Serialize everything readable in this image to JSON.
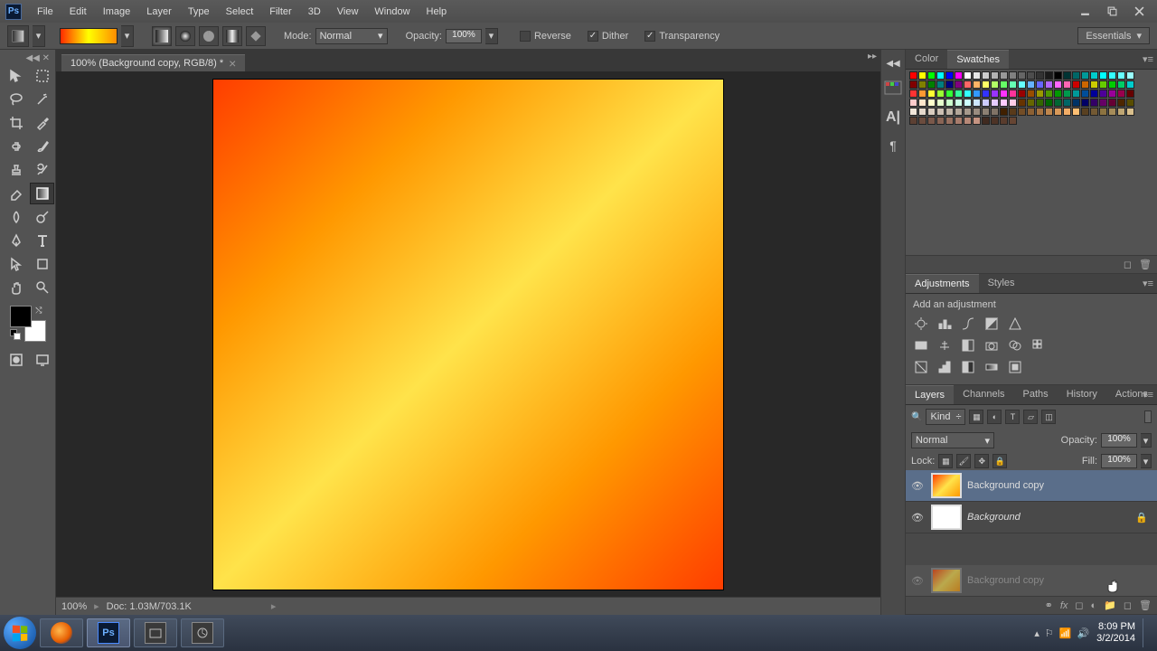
{
  "menu": {
    "items": [
      "File",
      "Edit",
      "Image",
      "Layer",
      "Type",
      "Select",
      "Filter",
      "3D",
      "View",
      "Window",
      "Help"
    ]
  },
  "window_controls": {
    "minimize": "–",
    "maximize": "❐",
    "close": "✕"
  },
  "options": {
    "mode_label": "Mode:",
    "mode_value": "Normal",
    "opacity_label": "Opacity:",
    "opacity_value": "100%",
    "reverse": "Reverse",
    "dither": "Dither",
    "transparency": "Transparency",
    "workspace": "Essentials"
  },
  "doc_tab": {
    "title": "100% (Background copy, RGB/8) *"
  },
  "status": {
    "zoom": "100%",
    "doc": "Doc: 1.03M/703.1K"
  },
  "color_panel": {
    "tabs": [
      "Color",
      "Swatches"
    ]
  },
  "adjustments_panel": {
    "tabs": [
      "Adjustments",
      "Styles"
    ],
    "add_label": "Add an adjustment"
  },
  "layers_panel": {
    "tabs": [
      "Layers",
      "Channels",
      "Paths",
      "History",
      "Actions"
    ],
    "kind": "Kind",
    "blend_mode": "Normal",
    "opacity_label": "Opacity:",
    "opacity_value": "100%",
    "lock_label": "Lock:",
    "fill_label": "Fill:",
    "fill_value": "100%",
    "layers": [
      {
        "name": "Background copy",
        "selected": true,
        "thumb": "grad",
        "locked": false,
        "visible": true,
        "italic": false
      },
      {
        "name": "Background",
        "selected": false,
        "thumb": "white",
        "locked": true,
        "visible": true,
        "italic": true
      }
    ],
    "ghost_name": "Background copy"
  },
  "tray": {
    "time": "8:09 PM",
    "date": "3/2/2014"
  },
  "foreground": "#000000",
  "background": "#ffffff",
  "swatches": [
    "#ff0000",
    "#ffff00",
    "#00ff00",
    "#00ffff",
    "#0000ff",
    "#ff00ff",
    "#ffffff",
    "#e6e6e6",
    "#cccccc",
    "#b3b3b3",
    "#999999",
    "#808080",
    "#666666",
    "#4d4d4d",
    "#333333",
    "#1a1a1a",
    "#000000",
    "#003333",
    "#006666",
    "#009999",
    "#00cccc",
    "#00ffff",
    "#33ffff",
    "#66ffff",
    "#99ffff",
    "#800000",
    "#808000",
    "#008000",
    "#008080",
    "#000080",
    "#800080",
    "#ff6666",
    "#ffb366",
    "#ffff66",
    "#b3ff66",
    "#66ff66",
    "#66ffb3",
    "#66ffff",
    "#66b3ff",
    "#6666ff",
    "#b366ff",
    "#ff66ff",
    "#ff66b3",
    "#cc0000",
    "#cc6600",
    "#cccc00",
    "#66cc00",
    "#00cc00",
    "#00cc66",
    "#00cccc",
    "#ff3333",
    "#ff9933",
    "#ffff33",
    "#99ff33",
    "#33ff33",
    "#33ff99",
    "#33ffff",
    "#3399ff",
    "#3333ff",
    "#9933ff",
    "#ff33ff",
    "#ff3399",
    "#990000",
    "#994d00",
    "#999900",
    "#4d9900",
    "#009900",
    "#00994d",
    "#009999",
    "#004d99",
    "#000099",
    "#4d0099",
    "#990099",
    "#99004d",
    "#660000",
    "#ffcccc",
    "#ffe6cc",
    "#ffffcc",
    "#e6ffcc",
    "#ccffcc",
    "#ccffe6",
    "#ccffff",
    "#cce6ff",
    "#ccccff",
    "#e6ccff",
    "#ffccff",
    "#ffcce6",
    "#663300",
    "#666600",
    "#336600",
    "#006600",
    "#006633",
    "#006666",
    "#003366",
    "#000066",
    "#330066",
    "#660066",
    "#660033",
    "#4d2600",
    "#594d00",
    "#f2e6d9",
    "#e6d9cc",
    "#d9ccbf",
    "#ccbfb3",
    "#bfb3a6",
    "#b3a699",
    "#a6998c",
    "#998c80",
    "#8c8073",
    "#807366",
    "#402000",
    "#593a1a",
    "#734d26",
    "#8c6033",
    "#a67340",
    "#bf864d",
    "#d99959",
    "#f2ac66",
    "#ffbf73",
    "#594020",
    "#735933",
    "#8c7340",
    "#a68c59",
    "#bfa673",
    "#d9bf8c",
    "#5c4033",
    "#6b4c3e",
    "#7a584a",
    "#896455",
    "#987060",
    "#a77c6c",
    "#b68877",
    "#c59482",
    "#402a20",
    "#4d3326",
    "#593c2d",
    "#664533"
  ]
}
